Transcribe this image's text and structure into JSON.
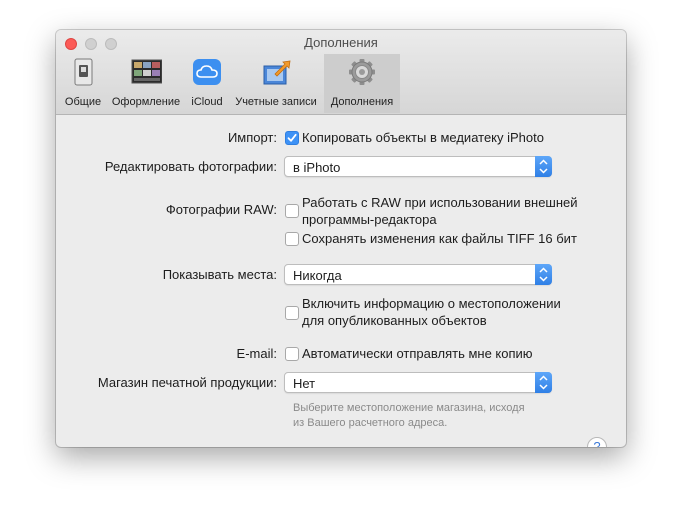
{
  "window": {
    "title": "Дополнения"
  },
  "toolbar": {
    "tabs": [
      {
        "label": "Общие",
        "icon": "switch-icon"
      },
      {
        "label": "Оформление",
        "icon": "appearance-icon"
      },
      {
        "label": "iCloud",
        "icon": "icloud-icon"
      },
      {
        "label": "Учетные записи",
        "icon": "accounts-icon"
      },
      {
        "label": "Дополнения",
        "icon": "gear-icon",
        "selected": true
      }
    ]
  },
  "form": {
    "import_label": "Импорт:",
    "import_option": "Копировать объекты в медиатеку iPhoto",
    "import_checked": true,
    "edit_label": "Редактировать фотографии:",
    "edit_value": "в iPhoto",
    "raw_label": "Фотографии RAW:",
    "raw_option1_line1": "Работать с RAW при использовании внешней",
    "raw_option1_line2": "программы-редактора",
    "raw_option1_checked": false,
    "raw_option2": "Сохранять изменения как файлы TIFF 16 бит",
    "raw_option2_checked": false,
    "places_label": "Показывать места:",
    "places_value": "Никогда",
    "location_line1": "Включить информацию о местоположении",
    "location_line2": "для опубликованных объектов",
    "location_checked": false,
    "email_label": "E-mail:",
    "email_option": "Автоматически отправлять мне копию",
    "email_checked": false,
    "store_label": "Магазин печатной продукции:",
    "store_value": "Нет",
    "store_hint_line1": "Выберите местоположение магазина, исходя",
    "store_hint_line2": "из Вашего расчетного адреса.",
    "help_label": "?"
  },
  "colors": {
    "accent": "#3e92f6",
    "close": "#fc5b57"
  }
}
